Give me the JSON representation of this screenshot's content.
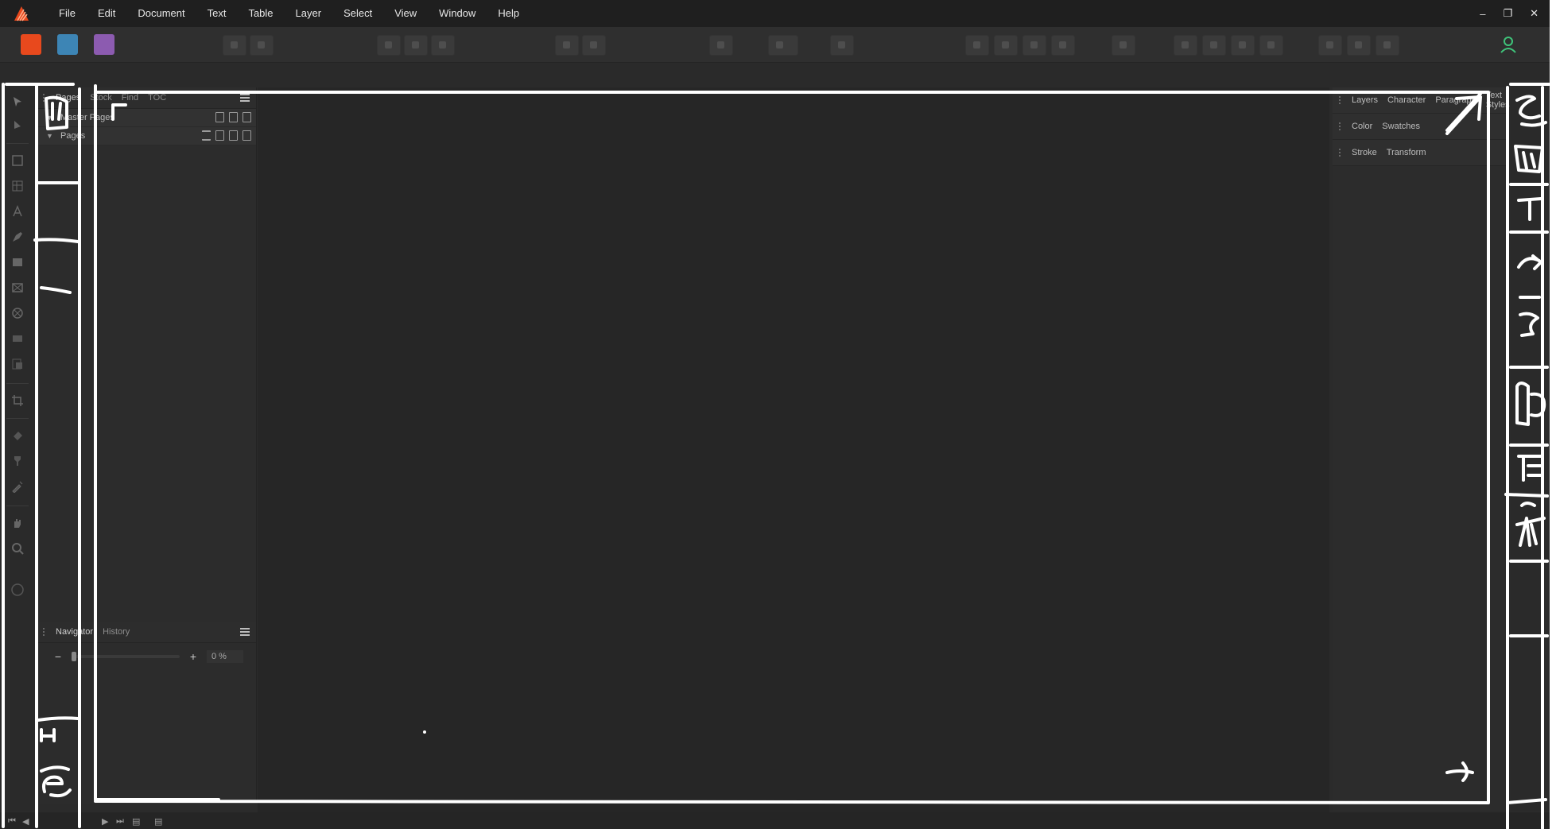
{
  "menubar": {
    "items": [
      "File",
      "Edit",
      "Document",
      "Text",
      "Table",
      "Layer",
      "Select",
      "View",
      "Window",
      "Help"
    ]
  },
  "window_controls": [
    "minimize-icon",
    "restore-icon",
    "close-icon"
  ],
  "personas": [
    {
      "name": "publisher-persona-icon",
      "color": "#e8491d"
    },
    {
      "name": "designer-persona-icon",
      "color": "#4fb1e6"
    },
    {
      "name": "photo-persona-icon",
      "color": "#b57bd9"
    }
  ],
  "pages_panel": {
    "tabs": [
      "Pages",
      "Stock",
      "Find",
      "TOC"
    ],
    "master_pages_label": "Master Pages",
    "pages_label": "Pages"
  },
  "navigator_panel": {
    "tabs": [
      "Navigator",
      "History"
    ],
    "zoom_value": "0 %"
  },
  "right_panels": {
    "row1": [
      "Layers",
      "Character",
      "Paragraph",
      "Text Styles"
    ],
    "row2": [
      "Color",
      "Swatches"
    ],
    "row3": [
      "Stroke",
      "Transform"
    ]
  },
  "colors": {
    "accent": "#e8491d",
    "account": "#3fc47a"
  }
}
